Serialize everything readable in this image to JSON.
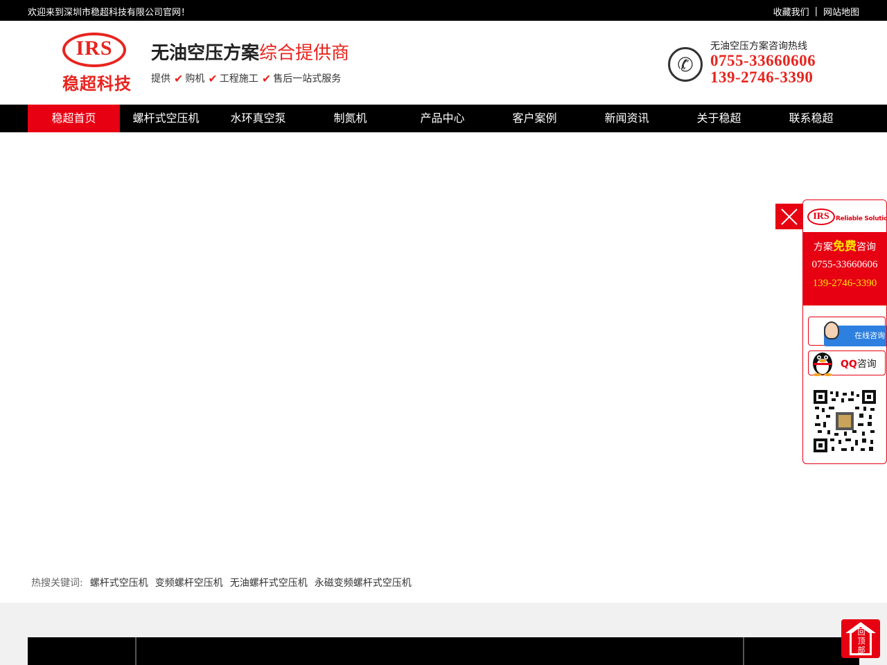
{
  "topbar": {
    "welcome": "欢迎来到深圳市稳超科技有限公司官网！",
    "favorite": "收藏我们",
    "separator": "|",
    "sitemap": "网站地图"
  },
  "header": {
    "logo_text": "IRS",
    "logo_cn": "稳超科技",
    "slogan_main": "无油空压方案",
    "slogan_red": "综合提供商",
    "slogan_sub": {
      "prefix": "提供",
      "items": [
        "购机",
        "工程施工",
        "售后一站式服务"
      ]
    },
    "hotline_label": "无油空压方案咨询热线",
    "hotline_1": "0755-33660606",
    "hotline_2": "139-2746-3390"
  },
  "nav": {
    "items": [
      "稳超首页",
      "螺杆式空压机",
      "水环真空泵",
      "制氮机",
      "产品中心",
      "客户案例",
      "新闻资讯",
      "关于稳超",
      "联系稳超"
    ],
    "active_index": 0
  },
  "keywords": {
    "label": "热搜关键词:",
    "items": [
      "螺杆式空压机",
      "变频螺杆空压机",
      "无油螺杆式空压机",
      "永磁变频螺杆式空压机"
    ]
  },
  "side_panel": {
    "brand_text": "IRS",
    "brand_tagline": "Reliable Solution",
    "consult_prefix": "方案",
    "consult_free": "免费",
    "consult_suffix": "咨询",
    "tel_1": "0755-33660606",
    "tel_2": "139-2746-3390",
    "online_label": "在线咨询",
    "qq_prefix": "QQ",
    "qq_suffix": "咨询"
  },
  "backtop": {
    "label": "回顶部"
  },
  "colors": {
    "brand_red": "#e60012",
    "top_bar": "#000000",
    "highlight_yellow": "#ffe400"
  }
}
